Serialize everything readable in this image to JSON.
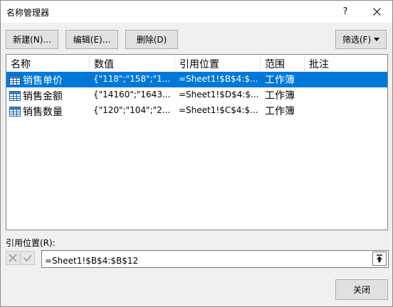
{
  "window": {
    "title": "名称管理器",
    "help_label": "?",
    "close_icon": "close-icon"
  },
  "toolbar": {
    "new_label": "新建(N)...",
    "edit_label": "编辑(E)...",
    "delete_label": "删除(D)",
    "filter_label": "筛选(F)"
  },
  "list": {
    "columns": [
      "名称",
      "数值",
      "引用位置",
      "范围",
      "批注"
    ],
    "rows": [
      {
        "name": "销售单价",
        "value": "{\"118\";\"158\";\"1...",
        "ref": "=Sheet1!$B$4:$...",
        "scope": "工作簿",
        "comment": "",
        "selected": true
      },
      {
        "name": "销售金额",
        "value": "{\"14160\";\"1643...",
        "ref": "=Sheet1!$D$4:$...",
        "scope": "工作簿",
        "comment": "",
        "selected": false
      },
      {
        "name": "销售数量",
        "value": "{\"120\";\"104\";\"2...",
        "ref": "=Sheet1!$C$4:$...",
        "scope": "工作簿",
        "comment": "",
        "selected": false
      }
    ]
  },
  "ref_panel": {
    "label": "引用位置(R):",
    "value": "=Sheet1!$B$4:$B$12"
  },
  "footer": {
    "close_label": "关闭"
  },
  "colors": {
    "selection": "#0078d7",
    "dialog_bg": "#f0f0f0",
    "button_bg": "#e1e1e1",
    "button_border": "#adadad"
  }
}
